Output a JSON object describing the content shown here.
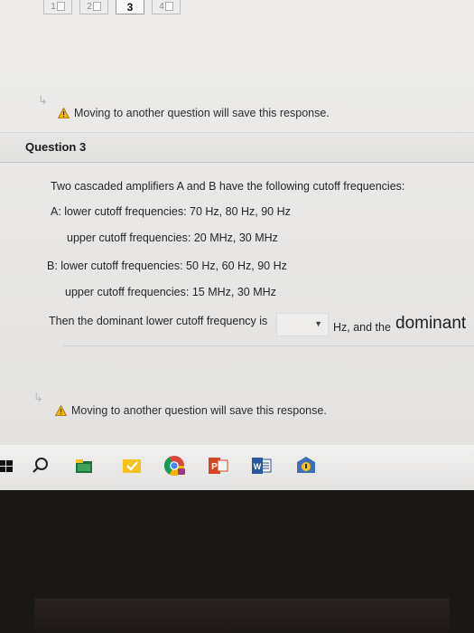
{
  "question_nav": {
    "items": [
      {
        "label": "1"
      },
      {
        "label": "2"
      },
      {
        "label": "3"
      },
      {
        "label": "4"
      }
    ]
  },
  "notice": {
    "text": "Moving to another question will save this response."
  },
  "question": {
    "title": "Question 3",
    "intro": "Two cascaded amplifiers A and B have the following cutoff frequencies:",
    "a_lower": "A: lower cutoff frequencies: 70 Hz, 80 Hz, 90 Hz",
    "a_upper": "upper cutoff frequencies: 20 MHz, 30 MHz",
    "b_lower": "B: lower cutoff frequencies: 50 Hz, 60 Hz, 90 Hz",
    "b_upper": "upper cutoff frequencies: 15 MHz, 30 MHz",
    "answer_prefix": "Then the dominant lower cutoff frequency is",
    "answer_unit": "Hz, and the",
    "answer_tail": "dominant",
    "dropdown_value": ""
  },
  "taskbar": {
    "icons": [
      "search-icon",
      "file-explorer-icon",
      "tasks-icon",
      "chrome-icon",
      "powerpoint-icon",
      "word-icon",
      "app-icon"
    ]
  },
  "colors": {
    "warning": "#f2b705",
    "chrome_red": "#db4437",
    "chrome_green": "#0f9d58",
    "chrome_yellow": "#f4b400",
    "powerpoint": "#d24726",
    "word": "#2b579a",
    "tasks_yellow": "#f6c21b"
  }
}
